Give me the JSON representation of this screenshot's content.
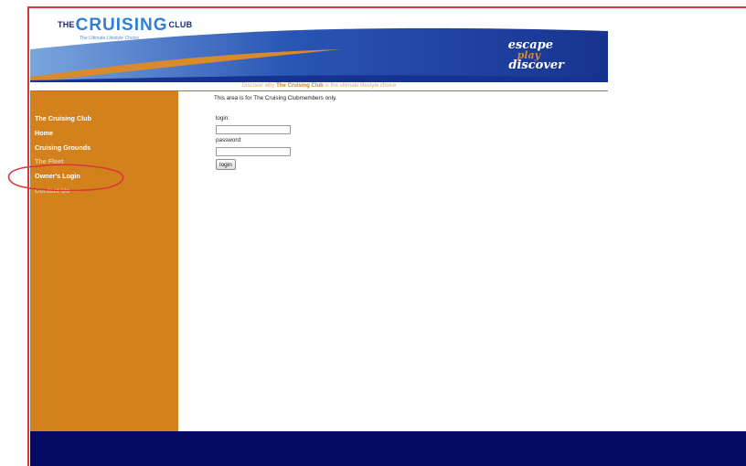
{
  "header": {
    "logo": {
      "prefix": "THE",
      "main": "CRUISING",
      "suffix": "CLUB",
      "tagline": "The Ultimate Lifestyle Choice"
    },
    "slogan": {
      "line1": "escape",
      "line2": "play",
      "line3": "discover"
    }
  },
  "tagline_bar": {
    "before": "Discover why",
    "brand": "The Cruising Club",
    "after": "is the ultimate lifestyle choice"
  },
  "sidebar": {
    "items": [
      {
        "label": "The Cruising Club"
      },
      {
        "label": "Home"
      },
      {
        "label": "Cruising Grounds"
      },
      {
        "label": "The Fleet"
      },
      {
        "label": "Owner's Login"
      },
      {
        "label": "Contact Us"
      }
    ]
  },
  "main": {
    "intro": "This area is for The Cruising Clubmembers only.",
    "login_label": "login:",
    "login_value": "",
    "password_label": "password:",
    "password_value": "",
    "button_label": "login"
  },
  "colors": {
    "sidebar": "#d2811c",
    "banner_blue": "#1b3b9a",
    "footer": "#070a62",
    "annotation": "#d9383a"
  }
}
